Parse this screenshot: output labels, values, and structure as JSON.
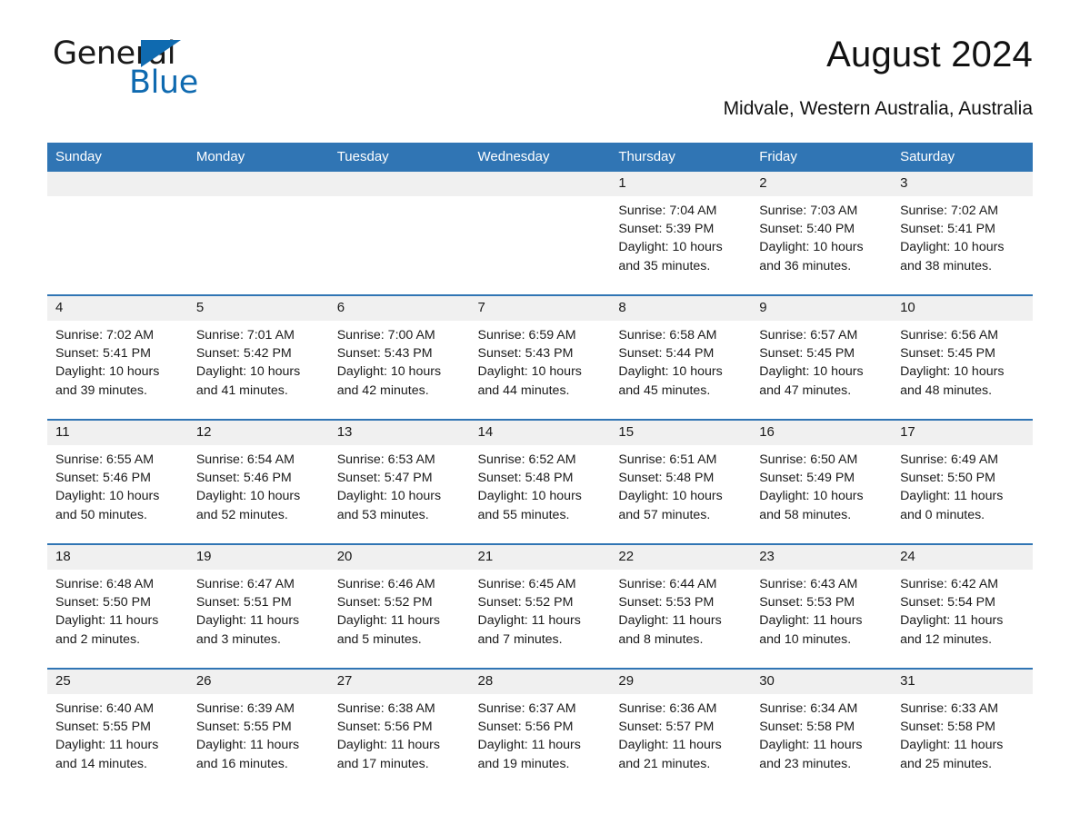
{
  "brand": {
    "name_part1": "General",
    "name_part2": "Blue",
    "accent_color": "#0f6ab0"
  },
  "header": {
    "title": "August 2024",
    "subtitle": "Midvale, Western Australia, Australia"
  },
  "calendar": {
    "header_bg": "#3075b4",
    "daynum_bg": "#f0f0f0",
    "weekdays": [
      "Sunday",
      "Monday",
      "Tuesday",
      "Wednesday",
      "Thursday",
      "Friday",
      "Saturday"
    ],
    "weeks": [
      [
        {
          "day": "",
          "blank": true,
          "sunrise": "",
          "sunset": "",
          "daylight": ""
        },
        {
          "day": "",
          "blank": true,
          "sunrise": "",
          "sunset": "",
          "daylight": ""
        },
        {
          "day": "",
          "blank": true,
          "sunrise": "",
          "sunset": "",
          "daylight": ""
        },
        {
          "day": "",
          "blank": true,
          "sunrise": "",
          "sunset": "",
          "daylight": ""
        },
        {
          "day": "1",
          "blank": false,
          "sunrise": "Sunrise: 7:04 AM",
          "sunset": "Sunset: 5:39 PM",
          "daylight": "Daylight: 10 hours and 35 minutes."
        },
        {
          "day": "2",
          "blank": false,
          "sunrise": "Sunrise: 7:03 AM",
          "sunset": "Sunset: 5:40 PM",
          "daylight": "Daylight: 10 hours and 36 minutes."
        },
        {
          "day": "3",
          "blank": false,
          "sunrise": "Sunrise: 7:02 AM",
          "sunset": "Sunset: 5:41 PM",
          "daylight": "Daylight: 10 hours and 38 minutes."
        }
      ],
      [
        {
          "day": "4",
          "blank": false,
          "sunrise": "Sunrise: 7:02 AM",
          "sunset": "Sunset: 5:41 PM",
          "daylight": "Daylight: 10 hours and 39 minutes."
        },
        {
          "day": "5",
          "blank": false,
          "sunrise": "Sunrise: 7:01 AM",
          "sunset": "Sunset: 5:42 PM",
          "daylight": "Daylight: 10 hours and 41 minutes."
        },
        {
          "day": "6",
          "blank": false,
          "sunrise": "Sunrise: 7:00 AM",
          "sunset": "Sunset: 5:43 PM",
          "daylight": "Daylight: 10 hours and 42 minutes."
        },
        {
          "day": "7",
          "blank": false,
          "sunrise": "Sunrise: 6:59 AM",
          "sunset": "Sunset: 5:43 PM",
          "daylight": "Daylight: 10 hours and 44 minutes."
        },
        {
          "day": "8",
          "blank": false,
          "sunrise": "Sunrise: 6:58 AM",
          "sunset": "Sunset: 5:44 PM",
          "daylight": "Daylight: 10 hours and 45 minutes."
        },
        {
          "day": "9",
          "blank": false,
          "sunrise": "Sunrise: 6:57 AM",
          "sunset": "Sunset: 5:45 PM",
          "daylight": "Daylight: 10 hours and 47 minutes."
        },
        {
          "day": "10",
          "blank": false,
          "sunrise": "Sunrise: 6:56 AM",
          "sunset": "Sunset: 5:45 PM",
          "daylight": "Daylight: 10 hours and 48 minutes."
        }
      ],
      [
        {
          "day": "11",
          "blank": false,
          "sunrise": "Sunrise: 6:55 AM",
          "sunset": "Sunset: 5:46 PM",
          "daylight": "Daylight: 10 hours and 50 minutes."
        },
        {
          "day": "12",
          "blank": false,
          "sunrise": "Sunrise: 6:54 AM",
          "sunset": "Sunset: 5:46 PM",
          "daylight": "Daylight: 10 hours and 52 minutes."
        },
        {
          "day": "13",
          "blank": false,
          "sunrise": "Sunrise: 6:53 AM",
          "sunset": "Sunset: 5:47 PM",
          "daylight": "Daylight: 10 hours and 53 minutes."
        },
        {
          "day": "14",
          "blank": false,
          "sunrise": "Sunrise: 6:52 AM",
          "sunset": "Sunset: 5:48 PM",
          "daylight": "Daylight: 10 hours and 55 minutes."
        },
        {
          "day": "15",
          "blank": false,
          "sunrise": "Sunrise: 6:51 AM",
          "sunset": "Sunset: 5:48 PM",
          "daylight": "Daylight: 10 hours and 57 minutes."
        },
        {
          "day": "16",
          "blank": false,
          "sunrise": "Sunrise: 6:50 AM",
          "sunset": "Sunset: 5:49 PM",
          "daylight": "Daylight: 10 hours and 58 minutes."
        },
        {
          "day": "17",
          "blank": false,
          "sunrise": "Sunrise: 6:49 AM",
          "sunset": "Sunset: 5:50 PM",
          "daylight": "Daylight: 11 hours and 0 minutes."
        }
      ],
      [
        {
          "day": "18",
          "blank": false,
          "sunrise": "Sunrise: 6:48 AM",
          "sunset": "Sunset: 5:50 PM",
          "daylight": "Daylight: 11 hours and 2 minutes."
        },
        {
          "day": "19",
          "blank": false,
          "sunrise": "Sunrise: 6:47 AM",
          "sunset": "Sunset: 5:51 PM",
          "daylight": "Daylight: 11 hours and 3 minutes."
        },
        {
          "day": "20",
          "blank": false,
          "sunrise": "Sunrise: 6:46 AM",
          "sunset": "Sunset: 5:52 PM",
          "daylight": "Daylight: 11 hours and 5 minutes."
        },
        {
          "day": "21",
          "blank": false,
          "sunrise": "Sunrise: 6:45 AM",
          "sunset": "Sunset: 5:52 PM",
          "daylight": "Daylight: 11 hours and 7 minutes."
        },
        {
          "day": "22",
          "blank": false,
          "sunrise": "Sunrise: 6:44 AM",
          "sunset": "Sunset: 5:53 PM",
          "daylight": "Daylight: 11 hours and 8 minutes."
        },
        {
          "day": "23",
          "blank": false,
          "sunrise": "Sunrise: 6:43 AM",
          "sunset": "Sunset: 5:53 PM",
          "daylight": "Daylight: 11 hours and 10 minutes."
        },
        {
          "day": "24",
          "blank": false,
          "sunrise": "Sunrise: 6:42 AM",
          "sunset": "Sunset: 5:54 PM",
          "daylight": "Daylight: 11 hours and 12 minutes."
        }
      ],
      [
        {
          "day": "25",
          "blank": false,
          "sunrise": "Sunrise: 6:40 AM",
          "sunset": "Sunset: 5:55 PM",
          "daylight": "Daylight: 11 hours and 14 minutes."
        },
        {
          "day": "26",
          "blank": false,
          "sunrise": "Sunrise: 6:39 AM",
          "sunset": "Sunset: 5:55 PM",
          "daylight": "Daylight: 11 hours and 16 minutes."
        },
        {
          "day": "27",
          "blank": false,
          "sunrise": "Sunrise: 6:38 AM",
          "sunset": "Sunset: 5:56 PM",
          "daylight": "Daylight: 11 hours and 17 minutes."
        },
        {
          "day": "28",
          "blank": false,
          "sunrise": "Sunrise: 6:37 AM",
          "sunset": "Sunset: 5:56 PM",
          "daylight": "Daylight: 11 hours and 19 minutes."
        },
        {
          "day": "29",
          "blank": false,
          "sunrise": "Sunrise: 6:36 AM",
          "sunset": "Sunset: 5:57 PM",
          "daylight": "Daylight: 11 hours and 21 minutes."
        },
        {
          "day": "30",
          "blank": false,
          "sunrise": "Sunrise: 6:34 AM",
          "sunset": "Sunset: 5:58 PM",
          "daylight": "Daylight: 11 hours and 23 minutes."
        },
        {
          "day": "31",
          "blank": false,
          "sunrise": "Sunrise: 6:33 AM",
          "sunset": "Sunset: 5:58 PM",
          "daylight": "Daylight: 11 hours and 25 minutes."
        }
      ]
    ]
  }
}
